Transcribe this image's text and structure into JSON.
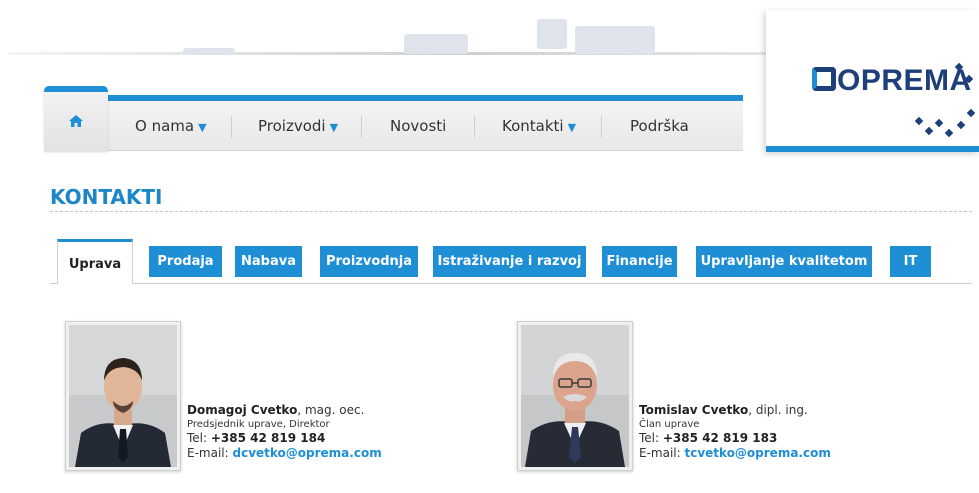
{
  "brand": {
    "logo_text": "OPREMA"
  },
  "nav": {
    "home_icon": "home-icon",
    "items": [
      {
        "label": "O nama",
        "has_dropdown": true
      },
      {
        "label": "Proizvodi",
        "has_dropdown": true
      },
      {
        "label": "Novosti",
        "has_dropdown": false
      },
      {
        "label": "Kontakti",
        "has_dropdown": true
      },
      {
        "label": "Podrška",
        "has_dropdown": false
      }
    ],
    "caret": "▼"
  },
  "page": {
    "title": "KONTAKTI"
  },
  "tabs": {
    "active": "Uprava",
    "items": [
      "Prodaja",
      "Nabava",
      "Proizvodnja",
      "Istraživanje i razvoj",
      "Financije",
      "Upravljanje kvalitetom",
      "IT"
    ]
  },
  "people": [
    {
      "name": "Domagoj Cvetko",
      "degree": ", mag. oec.",
      "role": "Predsjednik uprave, Direktor",
      "tel_label": "Tel: ",
      "tel": "+385 42 819 184",
      "email_label": "E-mail: ",
      "email": "dcvetko@oprema.com"
    },
    {
      "name": "Tomislav Cvetko",
      "degree": ", dipl. ing.",
      "role": "Član uprave",
      "tel_label": "Tel: ",
      "tel": "+385 42 819 183",
      "email_label": "E-mail: ",
      "email": "tcvetko@oprema.com"
    }
  ],
  "colors": {
    "accent": "#1e8fd5",
    "brand_dark": "#1d3f7a",
    "title": "#1d86c8"
  }
}
